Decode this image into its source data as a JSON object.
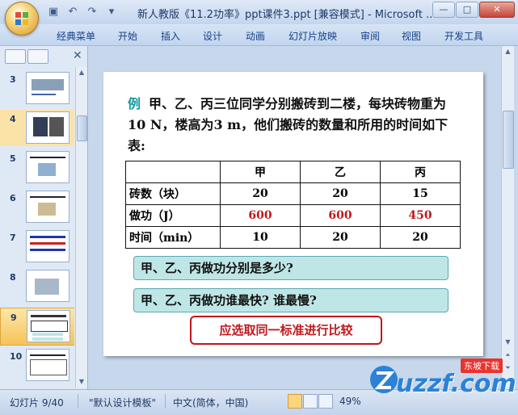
{
  "window": {
    "title": "新人教版《11.2功率》ppt课件3.ppt [兼容模式] - Microsoft ..."
  },
  "ribbon": {
    "tabs": [
      "经典菜单",
      "开始",
      "插入",
      "设计",
      "动画",
      "幻灯片放映",
      "审阅",
      "视图",
      "开发工具"
    ]
  },
  "thumbnails": {
    "items": [
      {
        "num": "3"
      },
      {
        "num": "4"
      },
      {
        "num": "5"
      },
      {
        "num": "6"
      },
      {
        "num": "7"
      },
      {
        "num": "8"
      },
      {
        "num": "9"
      },
      {
        "num": "10"
      }
    ],
    "selected": "9"
  },
  "slide": {
    "example_label": "例",
    "question": "甲、乙、丙三位同学分别搬砖到二楼，每块砖物重为10 N，楼高为3 m，他们搬砖的数量和所用的时间如下表:",
    "table": {
      "header": [
        "",
        "甲",
        "乙",
        "丙"
      ],
      "rows": [
        [
          "砖数（块）",
          "20",
          "20",
          "15"
        ],
        [
          "做功（J）",
          "600",
          "600",
          "450"
        ],
        [
          "时间（min）",
          "10",
          "20",
          "20"
        ]
      ]
    },
    "q1": "甲、乙、丙做功分别是多少?",
    "q2": "甲、乙、丙做功谁最快? 谁最慢?",
    "answer": "应选取同一标准进行比较"
  },
  "statusbar": {
    "slide_info": "幻灯片 9/40",
    "template": "\"默认设计模板\"",
    "language": "中文(简体，中国)",
    "zoom": "49%"
  },
  "watermark": {
    "site": "uzzf.com",
    "tag": "东坡下载"
  }
}
